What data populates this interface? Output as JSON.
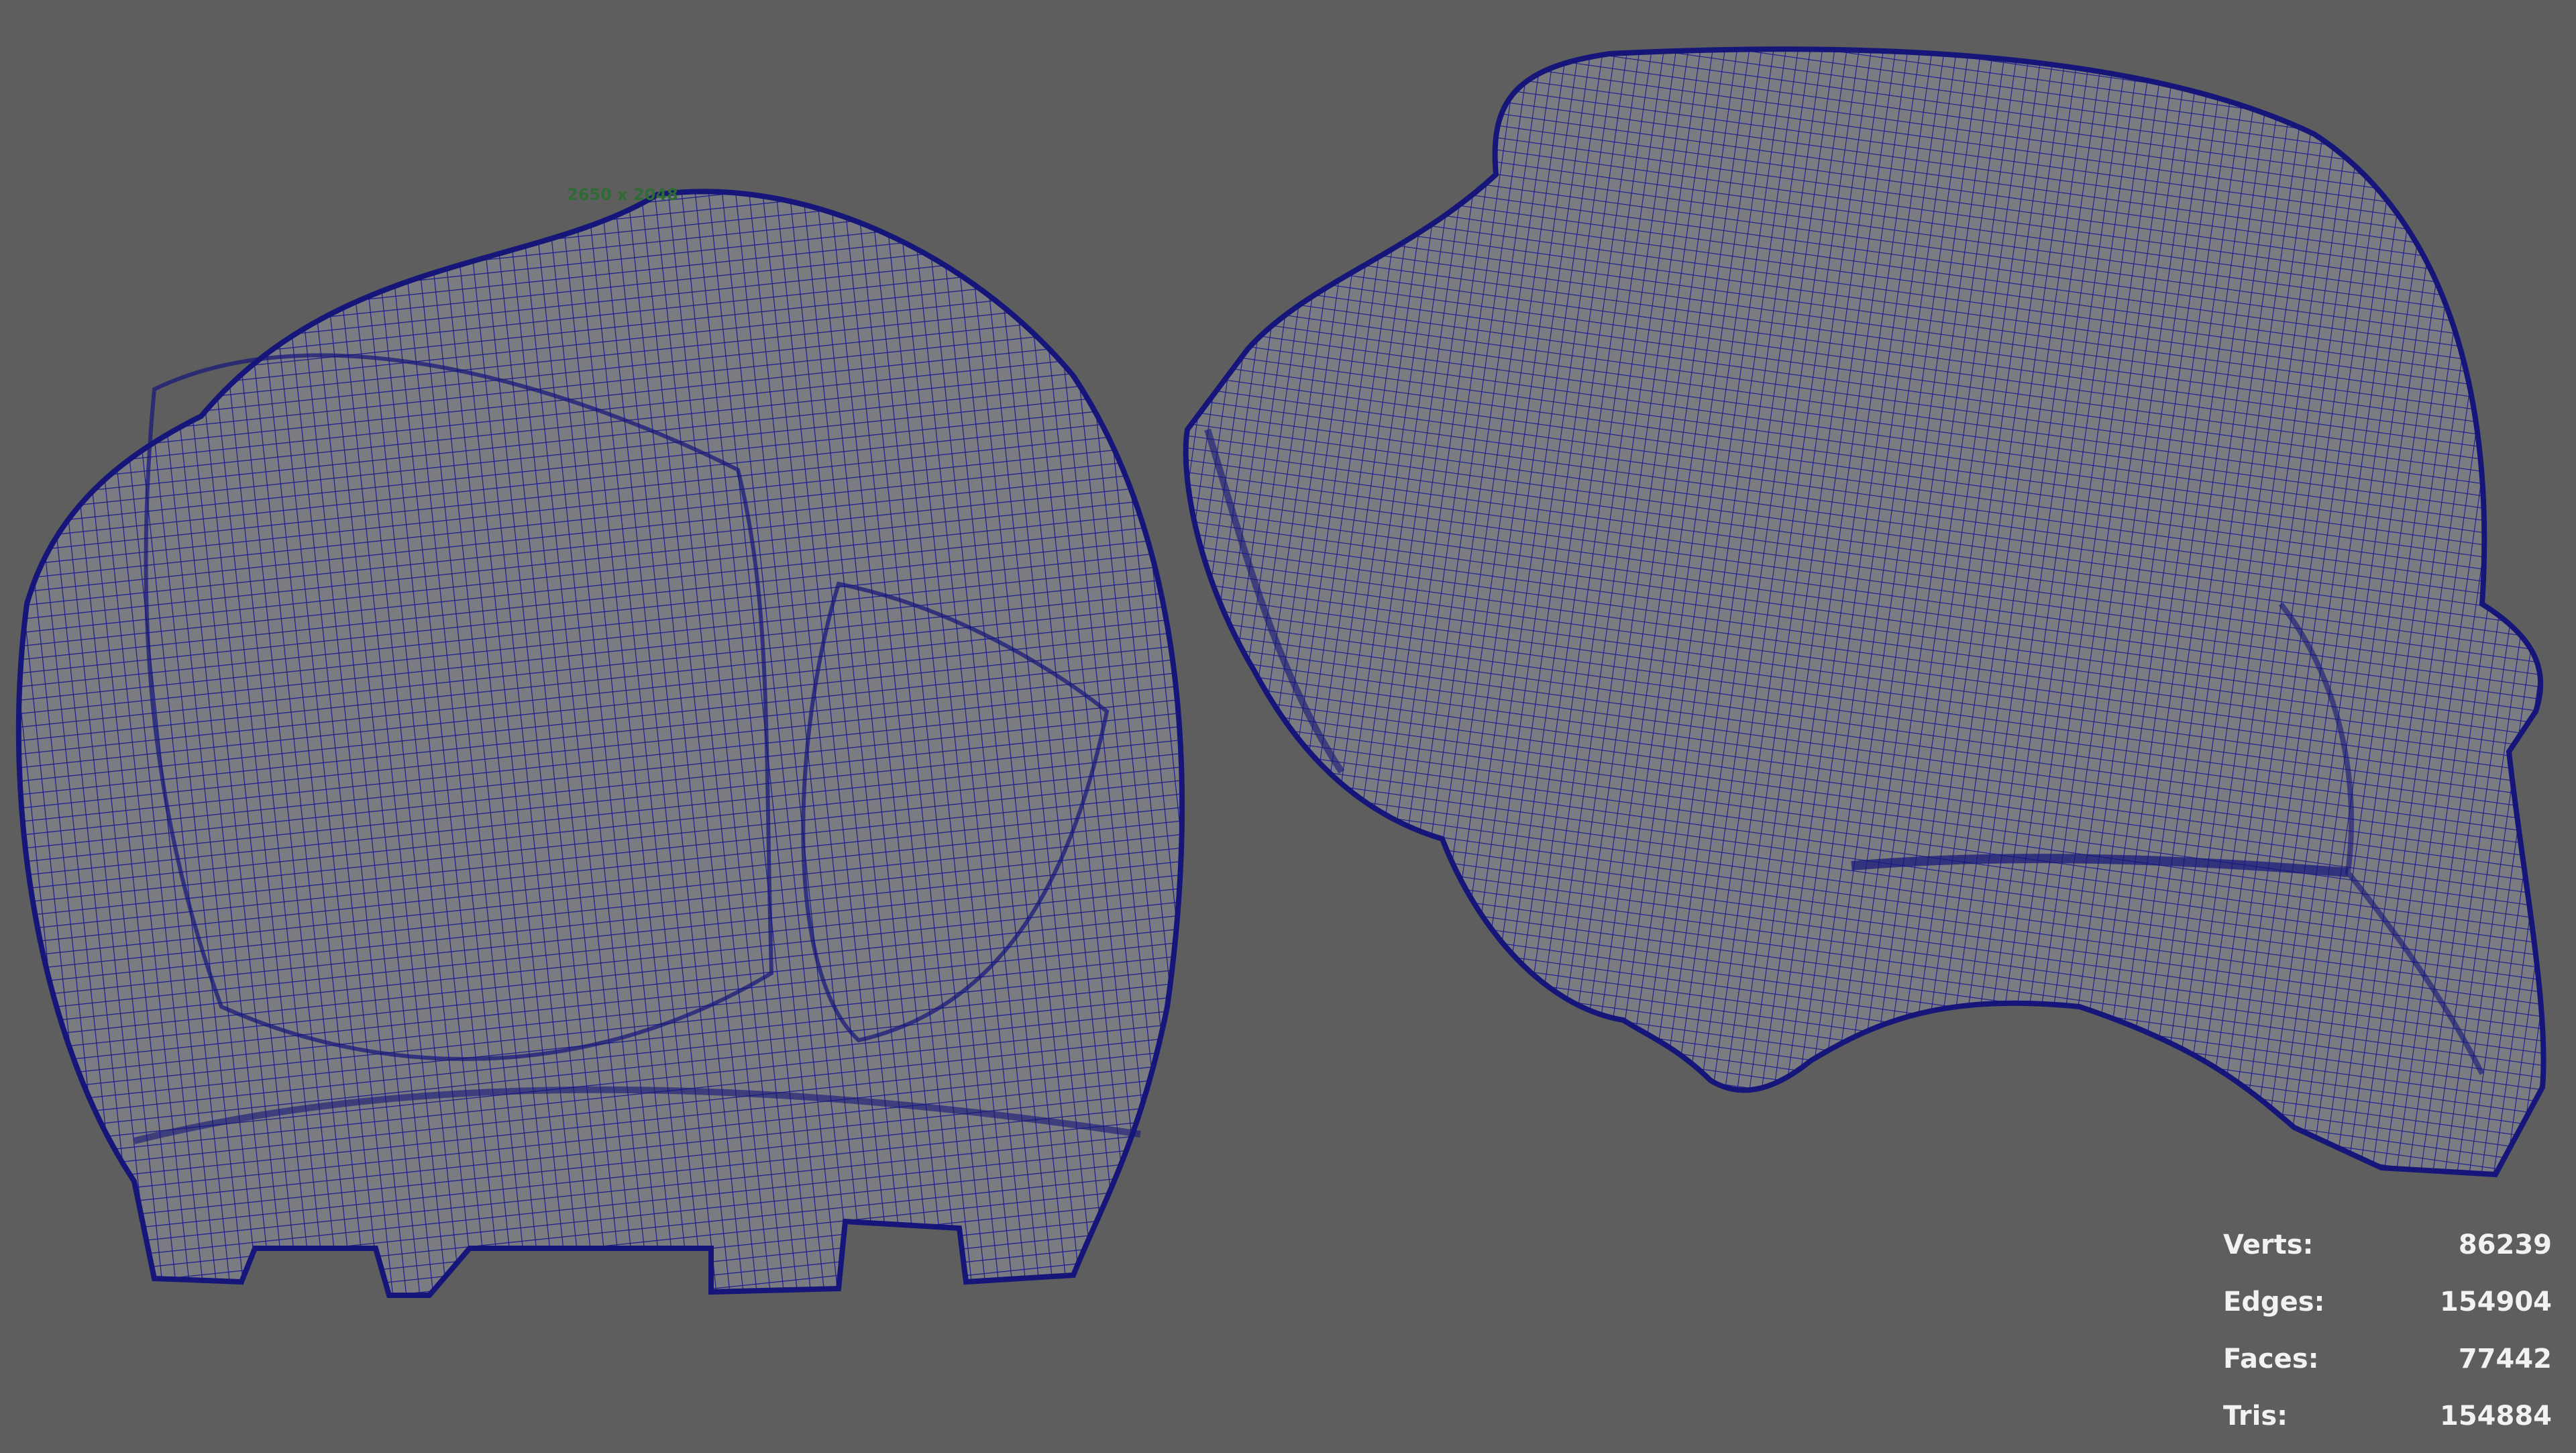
{
  "viewport": {
    "resolution_gate_label": "2650 x 2048",
    "colors": {
      "background": "#5e5e5e",
      "wireframe": "#1c1c8c",
      "mesh_fill": "#7b7b82"
    }
  },
  "heads_up_display": {
    "poly_count": [
      {
        "label": "Verts:",
        "value": "86239"
      },
      {
        "label": "Edges:",
        "value": "154904"
      },
      {
        "label": "Faces:",
        "value": "77442"
      },
      {
        "label": "Tris:",
        "value": "154884"
      }
    ]
  }
}
